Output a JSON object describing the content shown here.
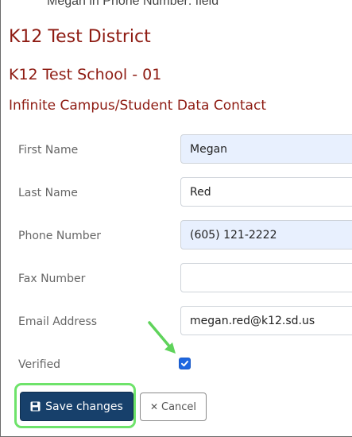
{
  "caption": "Megan in Phone Number: field",
  "headings": {
    "district": "K12 Test District",
    "school": "K12 Test School - 01",
    "contact": "Infinite Campus/Student Data Contact"
  },
  "fields": {
    "first_name": {
      "label": "First Name",
      "value": "Megan"
    },
    "last_name": {
      "label": "Last Name",
      "value": "Red"
    },
    "phone": {
      "label": "Phone Number",
      "value": "(605) 121-2222"
    },
    "fax": {
      "label": "Fax Number",
      "value": ""
    },
    "email": {
      "label": "Email Address",
      "value": "megan.red@k12.sd.us"
    },
    "verified": {
      "label": "Verified",
      "checked": true
    }
  },
  "actions": {
    "save_label": "Save changes",
    "cancel_label": "Cancel"
  },
  "colors": {
    "heading": "#8e1b12",
    "save_bg": "#17406b",
    "checkbox": "#1e67e0",
    "highlight": "#6ee36a"
  },
  "icons": {
    "save": "floppy-disk-icon",
    "cancel": "close-icon",
    "check": "checkmark-icon",
    "annotation": "green-arrow-icon"
  }
}
